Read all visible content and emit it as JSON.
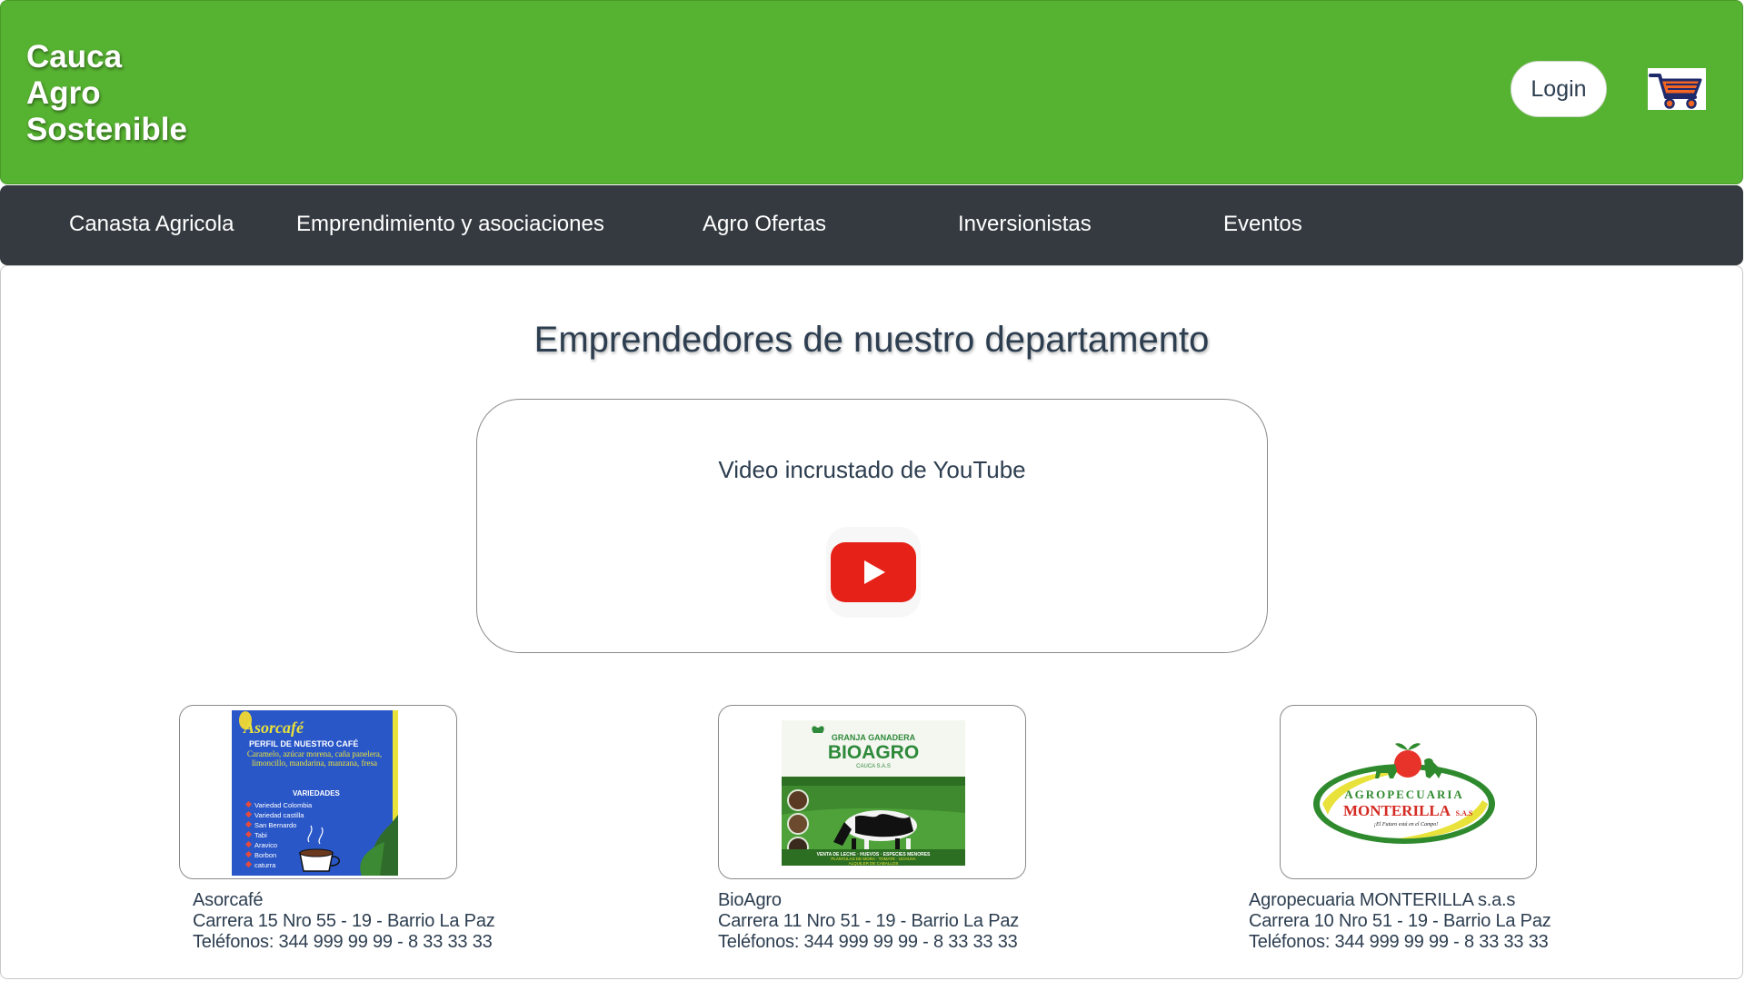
{
  "header": {
    "brand_lines": [
      "Cauca",
      "Agro",
      "Sostenible"
    ],
    "login_label": "Login",
    "cart_icon": "shopping-cart-icon"
  },
  "nav": {
    "items": [
      {
        "label": "Canasta Agricola"
      },
      {
        "label": "Emprendimiento y asociaciones"
      },
      {
        "label": "Agro Ofertas"
      },
      {
        "label": "Inversionistas"
      },
      {
        "label": "Eventos"
      }
    ]
  },
  "main": {
    "title": "Emprendedores de nuestro departamento",
    "video": {
      "label": "Video incrustado de YouTube",
      "icon": "youtube-play-icon"
    },
    "cards": [
      {
        "name": "Asorcafé",
        "address": "Carrera 15 Nro 55 - 19 - Barrio La Paz",
        "phones": "Teléfonos: 344 999 99 99 - 8 33 33 33",
        "image": {
          "brand": "Asorcafé",
          "heading": "PERFIL DE NUESTRO CAFÉ",
          "profile": "Caramelo, azúcar morena, caña panelera, limoncillo, mandarina, manzana, fresa",
          "varieties_label": "VARIEDADES",
          "varieties": [
            "Variedad Colombia",
            "Variedad castilla",
            "San Bernardo",
            "Tabi",
            "Aravico",
            "Borbon",
            "caturra"
          ]
        }
      },
      {
        "name": "BioAgro",
        "address": "Carrera 11 Nro 51 - 19 - Barrio La Paz",
        "phones": "Teléfonos: 344 999 99 99 - 8 33 33 33",
        "image": {
          "top_line": "GRANJA GANADERA",
          "brand": "BIOAGRO",
          "sub": "CAUCA S.A.S",
          "bottom_line1": "VENTA DE LECHE · HUEVOS · ESPECIES MENORES",
          "bottom_line2": "PLANTULAS DE MORA · TOMATE · UCHUVA",
          "bottom_line3": "ALQUILER DE CABALLOS"
        }
      },
      {
        "name": "Agropecuaria MONTERILLA s.a.s",
        "address": "Carrera 10 Nro 51 - 19 - Barrio La Paz",
        "phones": "Teléfonos: 344 999 99 99 - 8 33 33 33",
        "image": {
          "line1": "AGROPECUARIA",
          "line2": "MONTERILLA",
          "suffix": "S.A.S",
          "tagline": "¡El Futuro está en el Campo!"
        }
      }
    ]
  },
  "colors": {
    "header_green": "#56b231",
    "nav_dark": "#343a40",
    "text_dark": "#2d3e50",
    "youtube_red": "#e62117",
    "cart_orange": "#f26522",
    "cart_navy": "#1f2a6b"
  }
}
